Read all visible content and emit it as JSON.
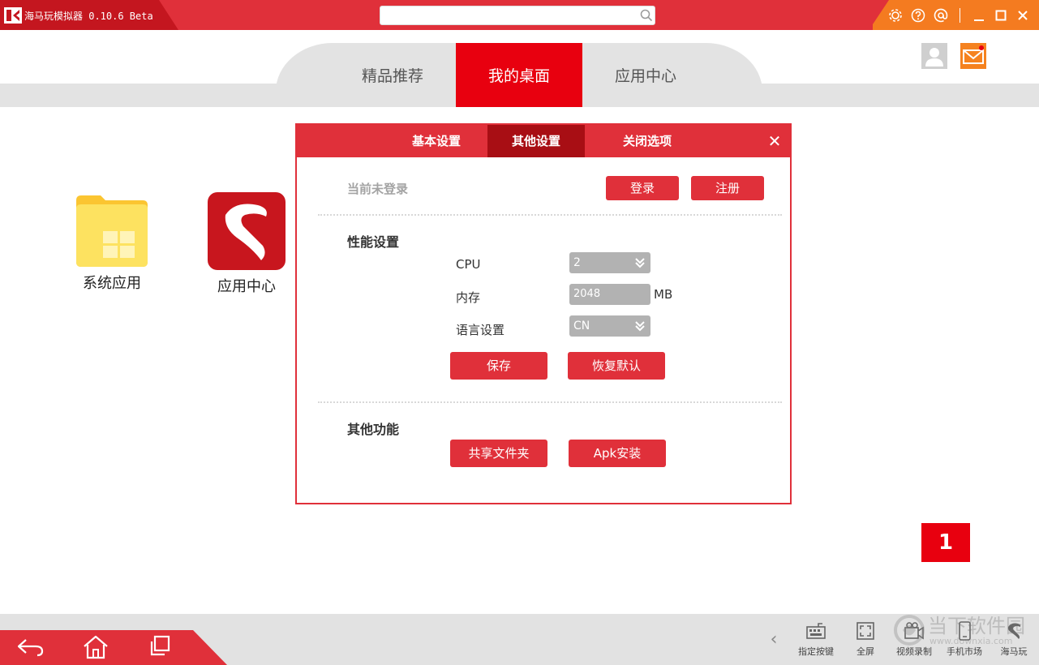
{
  "window": {
    "title": "海马玩模拟器 0.10.6 Beta",
    "search_value": ""
  },
  "titlebar_icons": [
    "gear-icon",
    "help-icon",
    "at-icon",
    "minimize-icon",
    "maximize-icon",
    "close-icon"
  ],
  "tabs": [
    {
      "label": "精品推荐",
      "active": false
    },
    {
      "label": "我的桌面",
      "active": true
    },
    {
      "label": "应用中心",
      "active": false
    }
  ],
  "desktop": {
    "icons": [
      {
        "label": "系统应用",
        "icon": "folder-icon"
      },
      {
        "label": "应用中心",
        "icon": "app-center-icon"
      }
    ],
    "badge": "1"
  },
  "dialog": {
    "tabs": [
      {
        "label": "基本设置",
        "active": false
      },
      {
        "label": "其他设置",
        "active": true
      },
      {
        "label": "关闭选项",
        "active": false
      }
    ],
    "login_status": "当前未登录",
    "login_button": "登录",
    "register_button": "注册",
    "performance": {
      "title": "性能设置",
      "cpu_label": "CPU",
      "cpu_value": "2",
      "memory_label": "内存",
      "memory_value": "2048",
      "memory_unit": "MB",
      "language_label": "语言设置",
      "language_value": "CN",
      "save_button": "保存",
      "restore_button": "恢复默认"
    },
    "other": {
      "title": "其他功能",
      "share_folder_button": "共享文件夹",
      "apk_install_button": "Apk安装"
    }
  },
  "bottombar": {
    "nav_icons": [
      "back-icon",
      "home-icon",
      "recent-apps-icon"
    ],
    "items": [
      {
        "label": "指定按键",
        "icon": "keyboard-icon"
      },
      {
        "label": "全屏",
        "icon": "fullscreen-icon"
      },
      {
        "label": "视频录制",
        "icon": "video-record-icon"
      },
      {
        "label": "手机市场",
        "icon": "phone-market-icon"
      },
      {
        "label": "海马玩",
        "icon": "haimawan-icon"
      }
    ]
  },
  "watermark": {
    "main": "当下软件园",
    "sub": "www.downxia.com"
  },
  "colors": {
    "brand_red": "#e0303a",
    "active_red": "#e8000f",
    "orange": "#f47b20",
    "dark_red": "#a80e14"
  }
}
